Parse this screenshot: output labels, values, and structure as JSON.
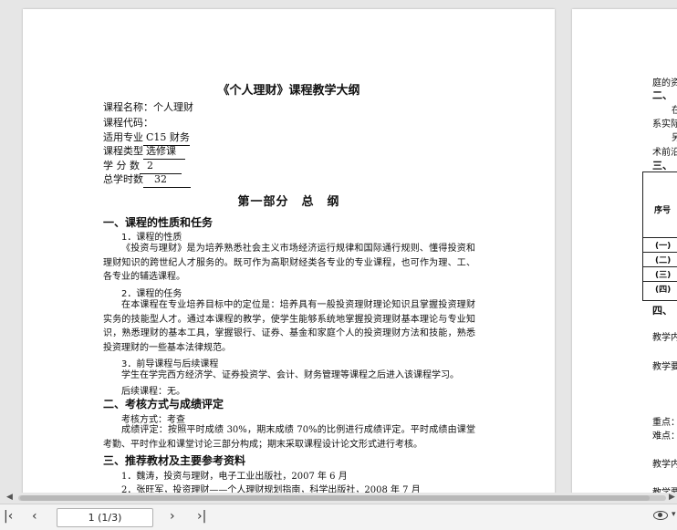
{
  "doc": {
    "title": "《个人理财》课程教学大纲",
    "course_name": "课程名称：个人理财",
    "course_code": "课程代码：",
    "major_label": "适用专业",
    "major_value": "C15 财务",
    "type_label": "课程类型",
    "type_value": "选修课",
    "credits_label": "学 分 数",
    "credits_value": "2",
    "hours_label": "总学时数",
    "hours_value": "32",
    "part_title": "第一部分　总　纲",
    "s1": "一、课程的性质和任务",
    "s1_1": "1．课程的性质",
    "s1_1_text": "《投资与理财》是为培养熟悉社会主义市场经济运行规律和国际通行规则、懂得投资和理财知识的跨世纪人才服务的。既可作为高职财经类各专业的专业课程，也可作为理、工、各专业的辅选课程。",
    "s1_2": "2．课程的任务",
    "s1_2_text": "在本课程在专业培养目标中的定位是：培养具有一般投资理财理论知识且掌握投资理财实务的技能型人才。通过本课程的教学，使学生能够系统地掌握投资理财基本理论与专业知识，熟悉理财的基本工具，掌握银行、证券、基金和家庭个人的投资理财方法和技能，熟悉投资理财的一些基本法律规范。",
    "s1_3": "3．前导课程与后续课程",
    "s1_3_text": "学生在学完西方经济学、证券投资学、会计、财务管理等课程之后进入该课程学习。",
    "s1_3_after": "后续课程：无。",
    "s2": "二、考核方式与成绩评定",
    "s2_method": "考核方式：考查",
    "s2_eval": "成绩评定：按照平时成绩 30%，期末成绩 70%的比例进行成绩评定。平时成绩由课堂考勤、平时作业和课堂讨论三部分构成；期末采取课程设计论文形式进行考核。",
    "s3": "三、推荐教材及主要参考资料",
    "ref1": "1．魏涛，投资与理财，电子工业出版社，2007 年 6 月",
    "ref2": "2．张旺军，投资理财——个人理财规划指南，科学出版社，2008 年 7 月"
  },
  "page2": {
    "l1": "庭的资",
    "h2": "二、",
    "l3": "在",
    "l4": "系实际",
    "l5": "另",
    "l6": "术前沿",
    "h3": "三、",
    "th": "序号",
    "r1": "(一)",
    "r2": "(二)",
    "r3": "(三)",
    "r4": "(四)",
    "h4": "四、",
    "c1": "教学内",
    "c2": "教学要",
    "c3": "重点：",
    "c4": "难点：",
    "c5": "教学内",
    "c6": "教学要"
  },
  "toolbar": {
    "page_indicator": "1 (1/3)",
    "first_icon": "first-page-icon",
    "prev_icon": "prev-page-icon",
    "next_icon": "next-page-icon",
    "last_icon": "last-page-icon",
    "view_icon": "eye-icon"
  }
}
